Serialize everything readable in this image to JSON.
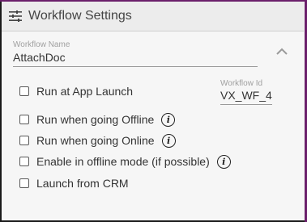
{
  "header": {
    "title": "Workflow Settings",
    "icon": "tune-icon"
  },
  "workflow_name": {
    "label": "Workflow Name",
    "value": "AttachDoc"
  },
  "workflow_id": {
    "label": "Workflow Id",
    "value": "VX_WF_4"
  },
  "options": [
    {
      "label": "Run at App Launch",
      "checked": false,
      "info": false
    },
    {
      "label": "Run when going Offline",
      "checked": false,
      "info": true
    },
    {
      "label": "Run when going Online",
      "checked": false,
      "info": true
    },
    {
      "label": "Enable in offline mode (if possible)",
      "checked": false,
      "info": true
    },
    {
      "label": "Launch from CRM",
      "checked": false,
      "info": false
    }
  ],
  "info_glyph": "i",
  "colors": {
    "accent": "#6b1f6b",
    "header_bg": "#ececec",
    "panel_bg": "#f6f6f6"
  }
}
